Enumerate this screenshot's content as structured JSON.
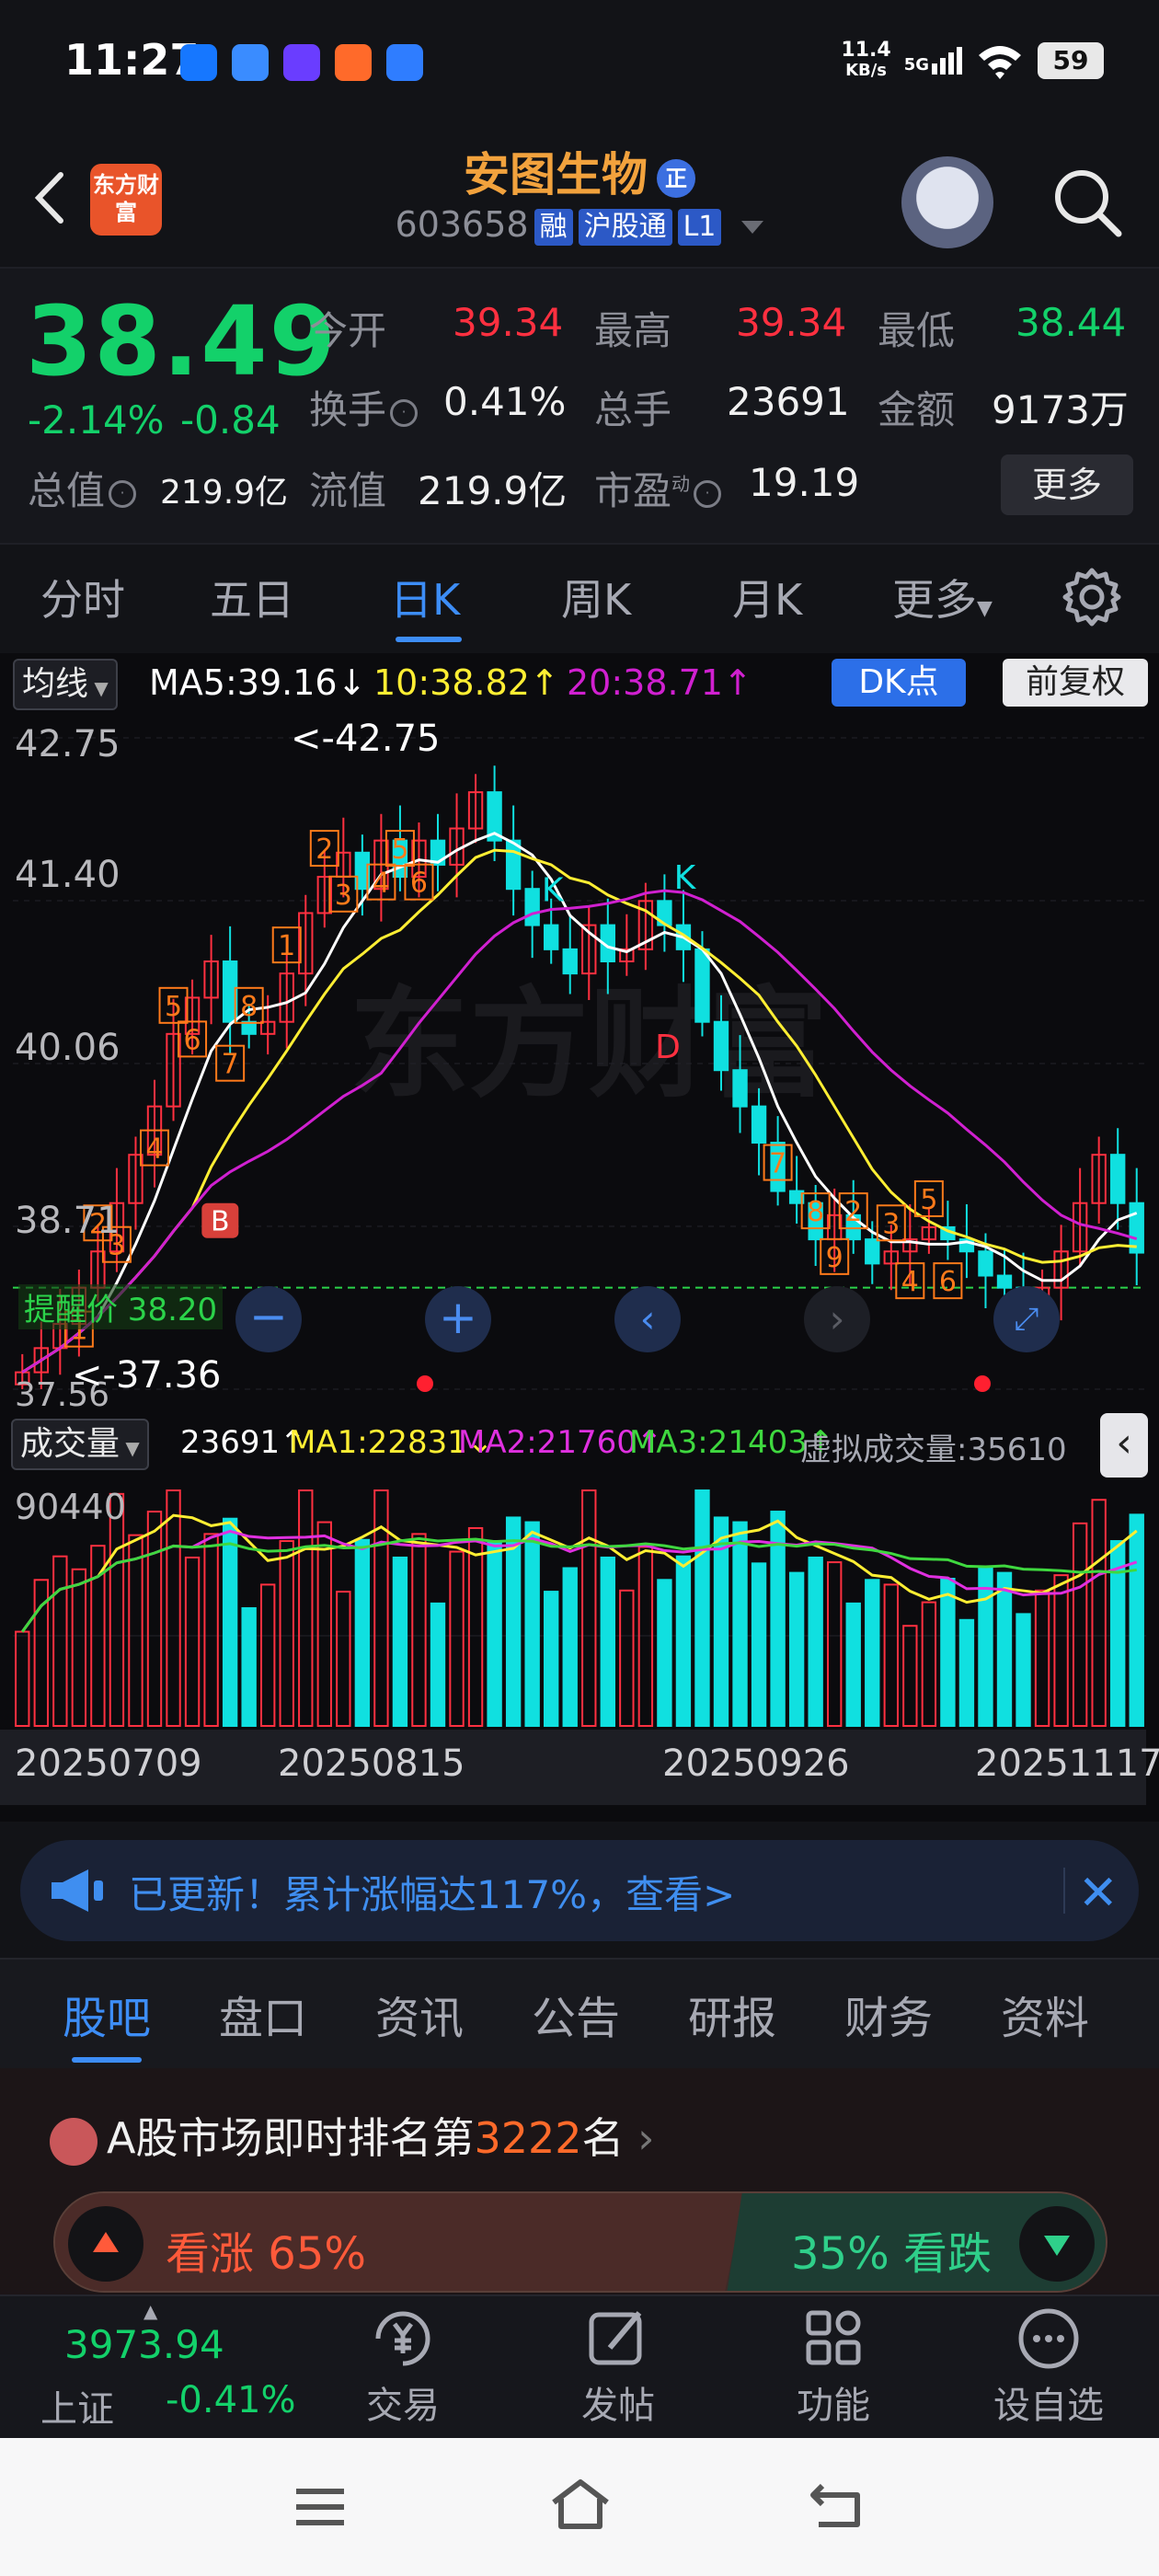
{
  "status": {
    "time": "11:27",
    "net_speed_value": "11.4",
    "net_speed_unit": "KB/s",
    "signal": "5G",
    "battery": "59"
  },
  "header": {
    "app_logo": "东方财富",
    "stock_name": "安图生物",
    "stock_name_badge": "正",
    "stock_code": "603658",
    "tags": [
      "融",
      "沪股通",
      "L1"
    ]
  },
  "quote": {
    "price": "38.49",
    "change_pct": "-2.14%",
    "change": "-0.84",
    "open_label": "今开",
    "open": "39.34",
    "high_label": "最高",
    "high": "39.34",
    "low_label": "最低",
    "low": "38.44",
    "turnover_label": "换手",
    "turnover": "0.41%",
    "volume_label": "总手",
    "volume": "23691",
    "amount_label": "金额",
    "amount": "9173万",
    "mktcap_label": "总值",
    "mktcap": "219.9亿",
    "float_label": "流值",
    "float": "219.9亿",
    "pe_label": "市盈",
    "pe_sup": "动",
    "pe": "19.19",
    "more": "更多"
  },
  "period_tabs": [
    "分时",
    "五日",
    "日K",
    "周K",
    "月K",
    "更多"
  ],
  "chart_legend": {
    "ma_selector": "均线",
    "ma5": "MA5:39.16",
    "ma5_arrow": "↓",
    "ma10": "10:38.82",
    "ma10_arrow": "↑",
    "ma20": "20:38.71",
    "ma20_arrow": "↑",
    "dk_btn": "DK点",
    "adjust_btn": "前复权"
  },
  "price_axis": [
    "42.75",
    "41.40",
    "40.06",
    "38.71",
    "37.56"
  ],
  "annotations": {
    "high_marker": "<-42.75",
    "low_marker": "<-37.36",
    "alert": "提醒价 38.20"
  },
  "volume_legend": {
    "selector": "成交量",
    "vol": "23691",
    "vol_arrow": "↑",
    "ma1": "MA1:22831",
    "ma1_arrow": "↓",
    "ma2": "MA2:21760",
    "ma2_arrow": "↑",
    "ma3": "MA3:21403",
    "ma3_arrow": "↑",
    "virtual": "虚拟成交量:35610"
  },
  "volume_axis_max": "90440",
  "date_axis": [
    "20250709",
    "20250815",
    "20250926",
    "20251117"
  ],
  "colors": {
    "up": "#ff3040",
    "down": "#10e0e0",
    "ma5": "#ffffff",
    "ma10": "#ffee33",
    "ma20": "#d020d0",
    "accent": "#3d8df6"
  },
  "banner": {
    "text": "已更新！累计涨幅达117%，查看>"
  },
  "sub_tabs": [
    "股吧",
    "盘口",
    "资讯",
    "公告",
    "研报",
    "财务",
    "资料"
  ],
  "ranking": {
    "prefix": "A股市场即时排名第",
    "rank": "3222",
    "suffix": "名"
  },
  "vote": {
    "up_label": "看涨",
    "up_pct": "65%",
    "down_label": "看跌",
    "down_pct": "35%"
  },
  "bottom_bar": {
    "index_value": "3973.94",
    "index_name": "上证",
    "index_change": "-0.41%",
    "items": [
      "交易",
      "发帖",
      "功能",
      "设自选"
    ]
  },
  "chart_data": {
    "type": "candlestick",
    "dates_shown": [
      "20250709",
      "20250815",
      "20250926",
      "20251117"
    ],
    "ylim": [
      37.36,
      42.75
    ],
    "close_approx": [
      37.5,
      37.7,
      37.9,
      38.2,
      38.5,
      38.9,
      39.3,
      39.7,
      40.3,
      40.6,
      40.9,
      40.4,
      40.3,
      40.4,
      40.8,
      41.3,
      41.6,
      41.8,
      41.5,
      41.9,
      41.6,
      41.9,
      41.7,
      42.0,
      42.3,
      41.9,
      41.5,
      41.2,
      41.0,
      40.8,
      41.2,
      40.9,
      41.0,
      41.4,
      41.2,
      41.0,
      40.4,
      40.0,
      39.7,
      39.4,
      39.0,
      38.9,
      38.6,
      38.8,
      38.6,
      38.4,
      38.5,
      38.6,
      38.7,
      38.6,
      38.5,
      38.3,
      38.2,
      38.1,
      38.2,
      38.5,
      38.9,
      39.3,
      38.9,
      38.49
    ],
    "series": [
      {
        "name": "MA5",
        "last": 39.16
      },
      {
        "name": "MA10",
        "last": 38.82
      },
      {
        "name": "MA20",
        "last": 38.71
      }
    ],
    "volume_max": 90440,
    "volume_last": 23691
  }
}
